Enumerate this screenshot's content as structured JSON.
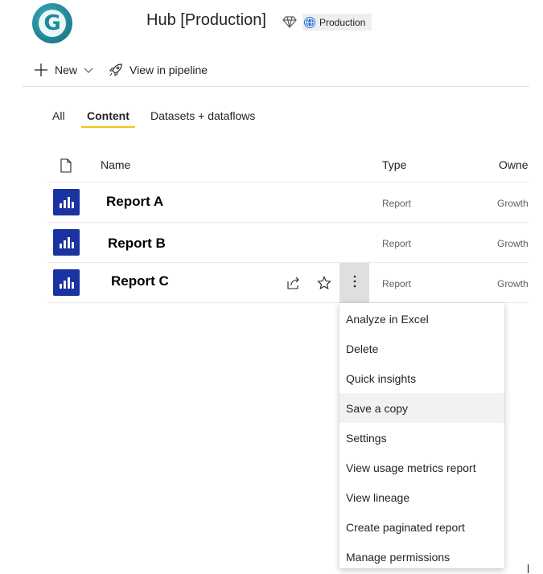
{
  "header": {
    "logo_letter": "G",
    "workspace_title": "Hub [Production]",
    "badge_label": "Production",
    "icons": {
      "premium": "diamond-icon",
      "badge": "globe-icon"
    }
  },
  "toolbar": {
    "new_label": "New",
    "view_pipeline_label": "View in pipeline",
    "icons": [
      "plus-icon",
      "chevron-down-icon",
      "rocket-icon"
    ]
  },
  "tabs": [
    {
      "label": "All",
      "active": false
    },
    {
      "label": "Content",
      "active": true
    },
    {
      "label": "Datasets + dataflows",
      "active": false
    }
  ],
  "table": {
    "columns": {
      "name": "Name",
      "type": "Type",
      "owner": "Owne"
    },
    "rows": [
      {
        "name": "Report A",
        "type": "Report",
        "owner": "Growth"
      },
      {
        "name": "Report B",
        "type": "Report",
        "owner": "Growth"
      },
      {
        "name": "Report C",
        "type": "Report",
        "owner": "Growth"
      }
    ],
    "row_icon": "report-chart-icon",
    "row_actions": [
      "share-icon",
      "star-icon",
      "more-options-icon"
    ]
  },
  "context_menu": {
    "items": [
      {
        "label": "Analyze in Excel",
        "hover": false
      },
      {
        "label": "Delete",
        "hover": false
      },
      {
        "label": "Quick insights",
        "hover": false
      },
      {
        "label": "Save a copy",
        "hover": true
      },
      {
        "label": "Settings",
        "hover": false
      },
      {
        "label": "View usage metrics report",
        "hover": false
      },
      {
        "label": "View lineage",
        "hover": false
      },
      {
        "label": "Create paginated report",
        "hover": false
      },
      {
        "label": "Manage permissions",
        "hover": false
      }
    ]
  },
  "colors": {
    "accent_tab": "#f2c811",
    "report_icon_bg": "#1a33a1",
    "logo_teal": "#1f7f8f",
    "menu_hover": "#f3f2f1",
    "selected_action_bg": "#e1dfdd"
  }
}
